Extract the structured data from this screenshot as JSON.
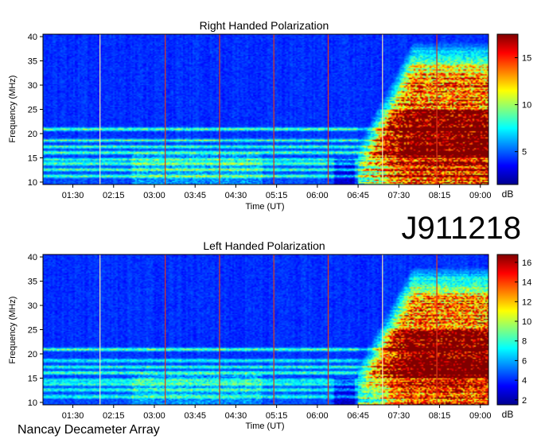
{
  "station": "Nancay Decameter Array",
  "observation_id": "J911218",
  "chart_data": [
    {
      "type": "heatmap",
      "title": "Right Handed Polarization",
      "xlabel": "Time (UT)",
      "ylabel": "Frequency (MHz)",
      "x_ticks": [
        "01:30",
        "02:15",
        "03:00",
        "03:45",
        "04:30",
        "05:15",
        "06:00",
        "06:45",
        "07:30",
        "08:15",
        "09:00"
      ],
      "x_tick_hours": [
        1.5,
        2.25,
        3.0,
        3.75,
        4.5,
        5.25,
        6.0,
        6.75,
        7.5,
        8.25,
        9.0
      ],
      "xlim_hours": [
        0.95,
        9.15
      ],
      "y_ticks": [
        10,
        15,
        20,
        25,
        30,
        35,
        40
      ],
      "ylim": [
        9.5,
        40.5
      ],
      "colorbar": {
        "label": "dB",
        "ticks": [
          5,
          10,
          15
        ],
        "range": [
          1.5,
          17.5
        ]
      },
      "marker_lines_hours": [
        2.0,
        3.2,
        4.2,
        5.2,
        6.2,
        7.2,
        8.2
      ],
      "emission": {
        "onset_time": "06:45",
        "peak_window": [
          "07:45",
          "09:00"
        ],
        "peak_freq_MHz": [
          15,
          25
        ],
        "max_freq_MHz": 39
      }
    },
    {
      "type": "heatmap",
      "title": "Left Handed Polarization",
      "xlabel": "Time (UT)",
      "ylabel": "Frequency (MHz)",
      "x_ticks": [
        "01:30",
        "02:15",
        "03:00",
        "03:45",
        "04:30",
        "05:15",
        "06:00",
        "06:45",
        "07:30",
        "08:15",
        "09:00"
      ],
      "x_tick_hours": [
        1.5,
        2.25,
        3.0,
        3.75,
        4.5,
        5.25,
        6.0,
        6.75,
        7.5,
        8.25,
        9.0
      ],
      "xlim_hours": [
        0.95,
        9.15
      ],
      "y_ticks": [
        10,
        15,
        20,
        25,
        30,
        35,
        40
      ],
      "ylim": [
        9.5,
        40.5
      ],
      "colorbar": {
        "label": "dB",
        "ticks": [
          2,
          4,
          6,
          8,
          10,
          12,
          14,
          16
        ],
        "range": [
          1.5,
          16.8
        ]
      },
      "marker_lines_hours": [
        2.0,
        3.2,
        4.2,
        5.2,
        6.2,
        7.2,
        8.2
      ],
      "emission": {
        "onset_time": "06:45",
        "peak_window": [
          "07:45",
          "09:00"
        ],
        "peak_freq_MHz": [
          15,
          25
        ],
        "max_freq_MHz": 38
      }
    }
  ]
}
